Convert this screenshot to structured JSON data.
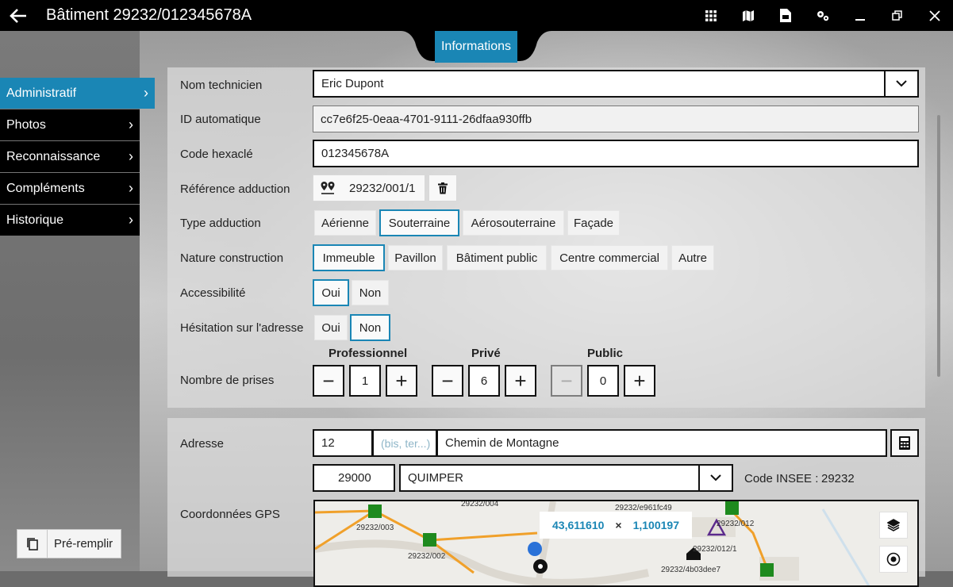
{
  "window": {
    "title": "Bâtiment 29232/012345678A"
  },
  "tab": {
    "label": "Informations"
  },
  "sidebar": {
    "items": [
      {
        "label": "Administratif",
        "active": true
      },
      {
        "label": "Photos"
      },
      {
        "label": "Reconnaissance"
      },
      {
        "label": "Compléments"
      },
      {
        "label": "Historique"
      }
    ],
    "prefill_label": "Pré-remplir"
  },
  "form": {
    "technicien": {
      "label": "Nom technicien",
      "value": "Eric Dupont"
    },
    "id_auto": {
      "label": "ID automatique",
      "value": "cc7e6f25-0eaa-4701-9111-26dfaa930ffb"
    },
    "hexacle": {
      "label": "Code hexaclé",
      "value": "012345678A"
    },
    "ref_adduction": {
      "label": "Référence adduction",
      "value": "29232/001/1"
    },
    "type_adduction": {
      "label": "Type adduction",
      "options": [
        "Aérienne",
        "Souterraine",
        "Aérosouterraine",
        "Façade"
      ],
      "selected": "Souterraine"
    },
    "nature": {
      "label": "Nature construction",
      "options": [
        "Immeuble",
        "Pavillon",
        "Bâtiment public",
        "Centre commercial",
        "Autre"
      ],
      "selected": "Immeuble"
    },
    "accessibilite": {
      "label": "Accessibilité",
      "options": [
        "Oui",
        "Non"
      ],
      "selected": "Oui"
    },
    "hesitation": {
      "label": "Hésitation sur l'adresse",
      "options": [
        "Oui",
        "Non"
      ],
      "selected": "Non"
    },
    "prises": {
      "label": "Nombre de prises",
      "professionnel": {
        "label": "Professionnel",
        "value": "1"
      },
      "prive": {
        "label": "Privé",
        "value": "6"
      },
      "public": {
        "label": "Public",
        "value": "0"
      },
      "minus": "−",
      "plus": "+"
    }
  },
  "adresse": {
    "label": "Adresse",
    "numero": "12",
    "complement_placeholder": "(bis, ter...)",
    "voie": "Chemin de Montagne",
    "code_postal": "29000",
    "commune": "QUIMPER",
    "insee_label": "Code INSEE :",
    "insee_value": "29232"
  },
  "gps": {
    "label": "Coordonnées GPS",
    "lat": "43,611610",
    "sep": "×",
    "lon": "1,100197",
    "map_labels": [
      "29232/004",
      "29232/e961fc49",
      "29232/003",
      "29232/012",
      "29232/002",
      "29232/012/1",
      "29232/4b03dee7"
    ]
  },
  "colors": {
    "accent": "#1a86b5",
    "titlebar": "#000000",
    "map_node": "#1e8a1e",
    "map_line": "#f0a02a"
  }
}
